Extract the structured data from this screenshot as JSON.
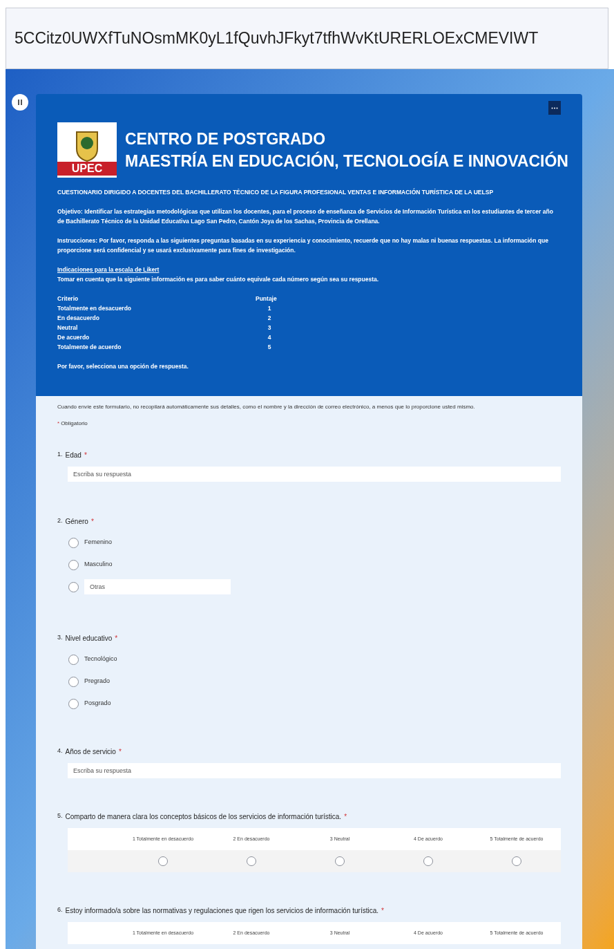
{
  "address_bar": {
    "url": "5CCitz0UWXfTuNOsmMK0yL1fQuvhJFkyt7tfhWvKtURERLOExCMEVIWT"
  },
  "header": {
    "logo_text": "UPEC",
    "title_lines": [
      "CENTRO DE POSTGRADO",
      "MAESTRÍA EN EDUCACIÓN, TECNOLOGÍA E INNOVACIÓN"
    ],
    "heading": "CUESTIONARIO DIRIGIDO A DOCENTES DEL BACHILLERATO TÉCNICO DE LA FIGURA PROFESIONAL VENTAS E INFORMACIÓN TURÍSTICA DE LA UELSP",
    "paragraphs": [
      "**Objetivo:** Identificar las estrategias metodológicas que utilizan los docentes, para el proceso de enseñanza de Servicios de Información Turística en los estudiantes de tercer año de Bachillerato Técnico de la Unidad Educativa Lago San Pedro, Cantón Joya de los Sachas, Provincia de Orellana.",
      "**Instrucciones:** Por favor, responda a las siguientes preguntas basadas en su experiencia y conocimiento, recuerde que no hay malas ni buenas respuestas. La información que proporcione será confidencial y se usará exclusivamente para fines de investigación."
    ],
    "scale_title": "Indicaciones para la escala de Likert",
    "scale_note": "Tomar en cuenta que la siguiente información es para saber cuánto equivale cada número según sea su respuesta.",
    "scale_columns": [
      "Criterio",
      "Puntaje"
    ],
    "scale_rows": [
      [
        "Totalmente en desacuerdo",
        "1"
      ],
      [
        "En desacuerdo",
        "2"
      ],
      [
        "Neutral",
        "3"
      ],
      [
        "De acuerdo",
        "4"
      ],
      [
        "Totalmente de acuerdo",
        "5"
      ]
    ],
    "closing": "Por favor, selecciona una opción de respuesta."
  },
  "privacy_note": "Cuando envíe este formulario, no recopilará automáticamente sus detalles, como el nombre y la dirección de correo electrónico, a menos que lo proporcione usted mismo.",
  "required_legend": {
    "mark": "*",
    "label": "Obligatorio"
  },
  "questions": [
    {
      "kind": "text",
      "number": "1.",
      "label": "Edad",
      "required_mark": "*",
      "placeholder": "Escriba su respuesta"
    },
    {
      "kind": "choice",
      "number": "2.",
      "label": "Género",
      "required_mark": "*",
      "options": [
        {
          "label": "Femenino",
          "selected": false
        },
        {
          "label": "Masculino",
          "selected": false
        },
        {
          "placeholder": "Otras",
          "selected": false
        }
      ]
    },
    {
      "kind": "choice",
      "number": "3.",
      "label": "Nivel educativo",
      "required_mark": "*",
      "options": [
        {
          "label": "Tecnológico",
          "selected": false
        },
        {
          "label": "Pregrado",
          "selected": false
        },
        {
          "label": "Posgrado",
          "selected": false
        }
      ]
    },
    {
      "kind": "text",
      "number": "4.",
      "label": "Años de servicio",
      "required_mark": "*",
      "placeholder": "Escriba su respuesta"
    },
    {
      "kind": "likert",
      "number": "5.",
      "label": "Comparto de manera clara los conceptos básicos de los servicios de información turística.",
      "required_mark": "*",
      "columns": [
        "1 Totalmente en desacuerdo",
        "2 En desacuerdo",
        "3 Neutral",
        "4 De acuerdo",
        "5 Totalmente de acuerdo"
      ],
      "selected": [
        false,
        false,
        false,
        false,
        false
      ]
    },
    {
      "kind": "likert",
      "number": "6.",
      "label": "Estoy informado/a sobre las normativas y regulaciones que rigen los servicios de información turística.",
      "required_mark": "*",
      "columns": [
        "1 Totalmente en desacuerdo",
        "2 En desacuerdo",
        "3 Neutral",
        "4 De acuerdo",
        "5 Totalmente de acuerdo"
      ]
    }
  ]
}
